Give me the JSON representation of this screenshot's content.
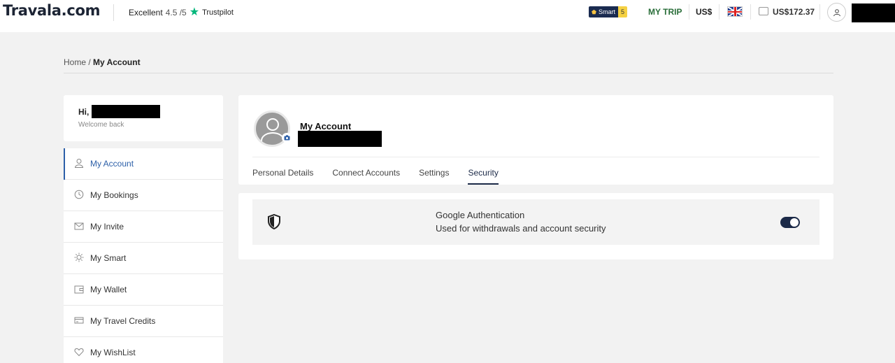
{
  "header": {
    "logo": "Travala.com",
    "rating_label": "Excellent",
    "rating_score": "4.5 /5",
    "trustpilot": "Trustpilot",
    "smart_label": "Smart",
    "smart_level": "5",
    "my_trip": "MY TRIP",
    "currency": "US$",
    "wallet_amount": "US$172.37"
  },
  "breadcrumb": {
    "home": "Home",
    "separator": " / ",
    "current": "My Account"
  },
  "sidebar": {
    "greeting": "Hi,",
    "welcome": "Welcome back",
    "items": [
      {
        "label": "My Account",
        "icon": "user-icon"
      },
      {
        "label": "My Bookings",
        "icon": "clock-icon"
      },
      {
        "label": "My Invite",
        "icon": "envelope-icon"
      },
      {
        "label": "My Smart",
        "icon": "sun-icon"
      },
      {
        "label": "My Wallet",
        "icon": "wallet-icon"
      },
      {
        "label": "My Travel Credits",
        "icon": "credit-card-icon"
      },
      {
        "label": "My WishList",
        "icon": "heart-icon"
      }
    ]
  },
  "main": {
    "title": "My Account",
    "tabs": [
      "Personal Details",
      "Connect Accounts",
      "Settings",
      "Security"
    ],
    "active_tab": "Security"
  },
  "security": {
    "title": "Google Authentication",
    "subtitle": "Used for withdrawals and account security",
    "enabled": true
  },
  "colors": {
    "accent": "#2c5fa8",
    "navy": "#1c2a48",
    "trustpilot_green": "#00b67a",
    "my_trip_green": "#2a6e3a"
  }
}
